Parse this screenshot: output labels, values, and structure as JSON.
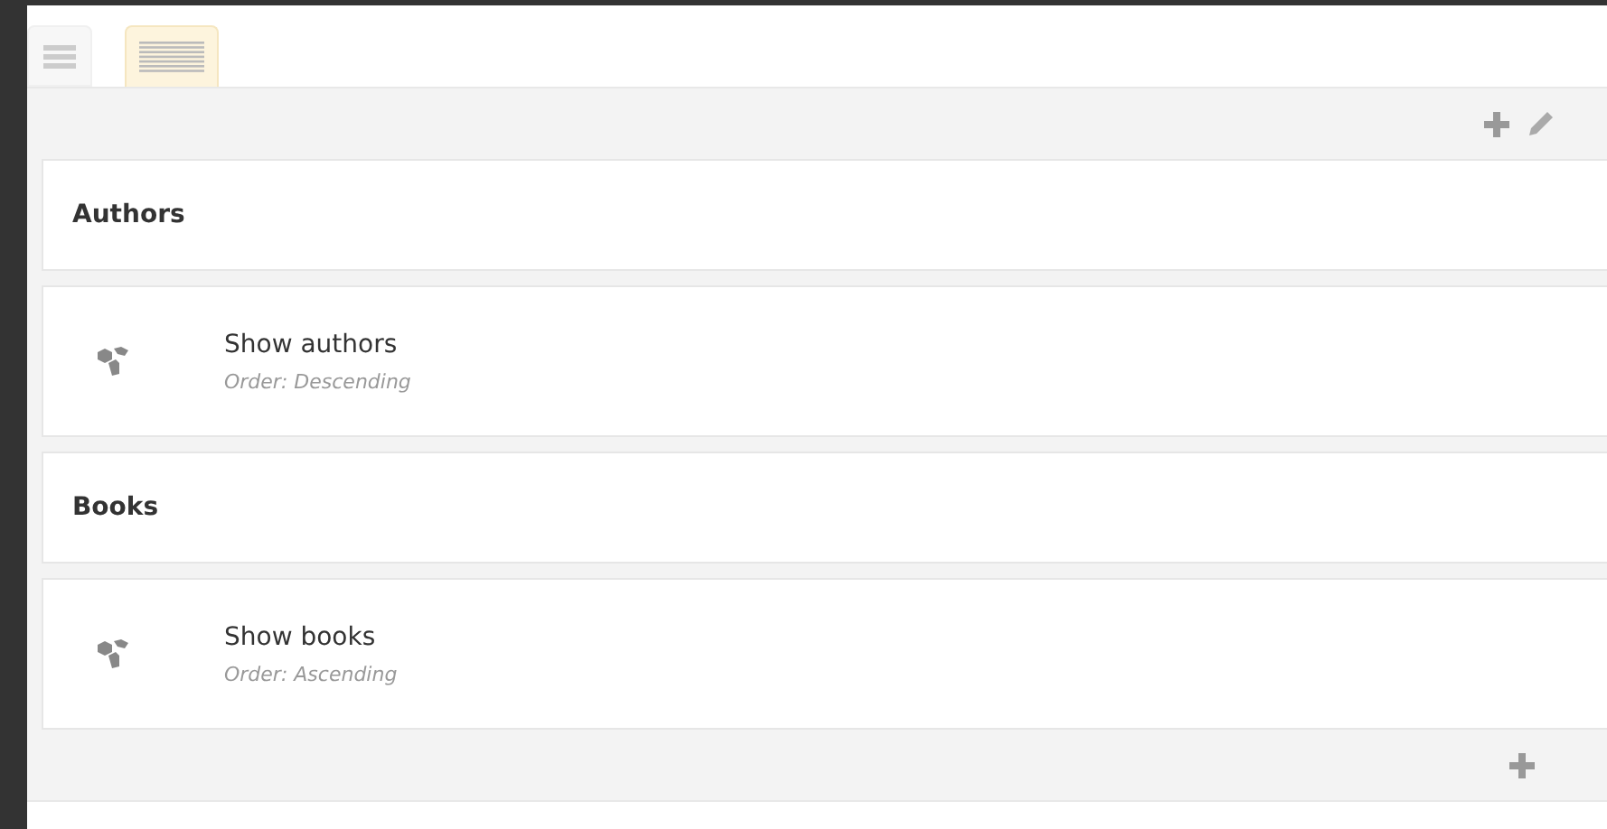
{
  "view_tabs": [
    {
      "kind": "list",
      "selected": false
    },
    {
      "kind": "compact",
      "selected": true
    }
  ],
  "rows": [
    {
      "kind": "header",
      "title": "Authors"
    },
    {
      "kind": "item",
      "title": "Show authors",
      "subtitle": "Order: Descending"
    },
    {
      "kind": "header",
      "title": "Books"
    },
    {
      "kind": "item",
      "title": "Show books",
      "subtitle": "Order: Ascending"
    }
  ]
}
